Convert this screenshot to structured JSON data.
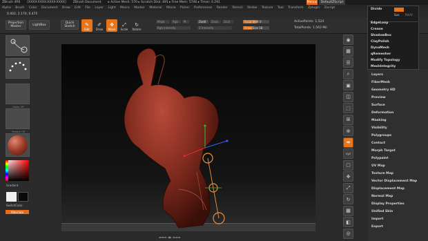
{
  "titlebar": {
    "app": "ZBrush 4R6",
    "build": "[XXXX-XXXX-XXXX-XXXX]",
    "doc": "ZBrush Document",
    "active": "▸ Active Mesh: 570 ▸ Scratch Disk: 491 ▸ Free Mem: 5746 ▸ Timer: 0.291",
    "menus_btn": "Menus",
    "script_btn": "DefaultZScript"
  },
  "menubar": [
    "Alpha",
    "Brush",
    "Color",
    "Document",
    "Draw",
    "Edit",
    "File",
    "Layer",
    "Light",
    "Macro",
    "Marker",
    "Material",
    "Movie",
    "Picker",
    "Preferences",
    "Render",
    "Stencil",
    "Stroke",
    "Texture",
    "Tool",
    "Transform",
    "Zplugin",
    "Zscript"
  ],
  "coords": "0.402, 2.170, 0.475",
  "toolbar": {
    "projection_master": "Projection Master",
    "lightbox": "LightBox",
    "quick_sketch": "Quick Sketch",
    "icons": [
      {
        "label": "Edit",
        "glyph": "✎",
        "on": true
      },
      {
        "label": "Draw",
        "glyph": "✐",
        "on": false
      },
      {
        "label": "Move",
        "glyph": "✥",
        "on": true
      },
      {
        "label": "Scale",
        "glyph": "⤢",
        "on": false
      },
      {
        "label": "Rotate",
        "glyph": "↻",
        "on": false
      }
    ],
    "mrgb": "Mrgb",
    "rgb": "Rgb",
    "m": "M",
    "zadd": "Zadd",
    "zsub": "Zsub",
    "zcut": "Zcut",
    "rgb_intensity": "Rgb Intensity",
    "z_intensity": "Z Intensity",
    "focal_shift": "Focal Shift 0",
    "draw_size": "Draw Size 18",
    "active_points": "ActivePoints: 1,524",
    "total_points": "TotalPoints: 1.562 Mil"
  },
  "lefttray": {
    "thumb_captions": [
      "",
      "",
      "",
      "Alpha Off",
      "Texture Off"
    ],
    "gradient": "Gradient",
    "switch_color": "SwitchColor",
    "alternate": "Alternate"
  },
  "right_icons": [
    {
      "label": "BPR",
      "glyph": "◉"
    },
    {
      "label": "SPix 3",
      "glyph": "▦"
    },
    {
      "label": "Scroll",
      "glyph": "☰"
    },
    {
      "label": "Zoom",
      "glyph": "⌕"
    },
    {
      "label": "Actual",
      "glyph": "▣"
    },
    {
      "label": "AAHalf",
      "glyph": "◫"
    },
    {
      "label": "Persp",
      "glyph": "⬚"
    },
    {
      "label": "Floor",
      "glyph": "⊞"
    },
    {
      "label": "Local",
      "glyph": "⊕"
    },
    {
      "label": "LSym",
      "glyph": "⇹"
    },
    {
      "label": "Xyz",
      "glyph": "xyz"
    },
    {
      "label": "Frame",
      "glyph": "▢"
    },
    {
      "label": "Move",
      "glyph": "✥"
    },
    {
      "label": "Scale",
      "glyph": "⤢"
    },
    {
      "label": "Rotate",
      "glyph": "↻"
    },
    {
      "label": "Line Fill",
      "glyph": "▩"
    },
    {
      "label": "Transp",
      "glyph": "◧"
    },
    {
      "label": "Solo",
      "glyph": "◎"
    }
  ],
  "palette": [
    "Layers",
    "FiberMesh",
    "Geometry HD",
    "Preview",
    "Surface",
    "Deformation",
    "Masking",
    "Visibility",
    "Polygroups",
    "Contact",
    "Morph Target",
    "Polypaint",
    "UV Map",
    "Texture Map",
    "Vector Displacement Map",
    "Displacement Map",
    "Normal Map",
    "Display Properties",
    "Unified Skin",
    "Import",
    "Export"
  ],
  "dropdown": [
    "Divide",
    "EdgeLoop",
    "Crease",
    "ShadowBox",
    "ClayPolish",
    "DynaMesh",
    "qRemesher",
    "Modify Topology",
    "MeshIntegrity"
  ],
  "dropdown_sub": {
    "a": "Smt",
    "b": "Suv",
    "c": "ReUV"
  },
  "statusbar": "▬▬▬ ◀▶ ▬▬▬",
  "colors": {
    "accent": "#e8751a",
    "bg": "#2a2a2a",
    "model": "#8a2e22"
  }
}
